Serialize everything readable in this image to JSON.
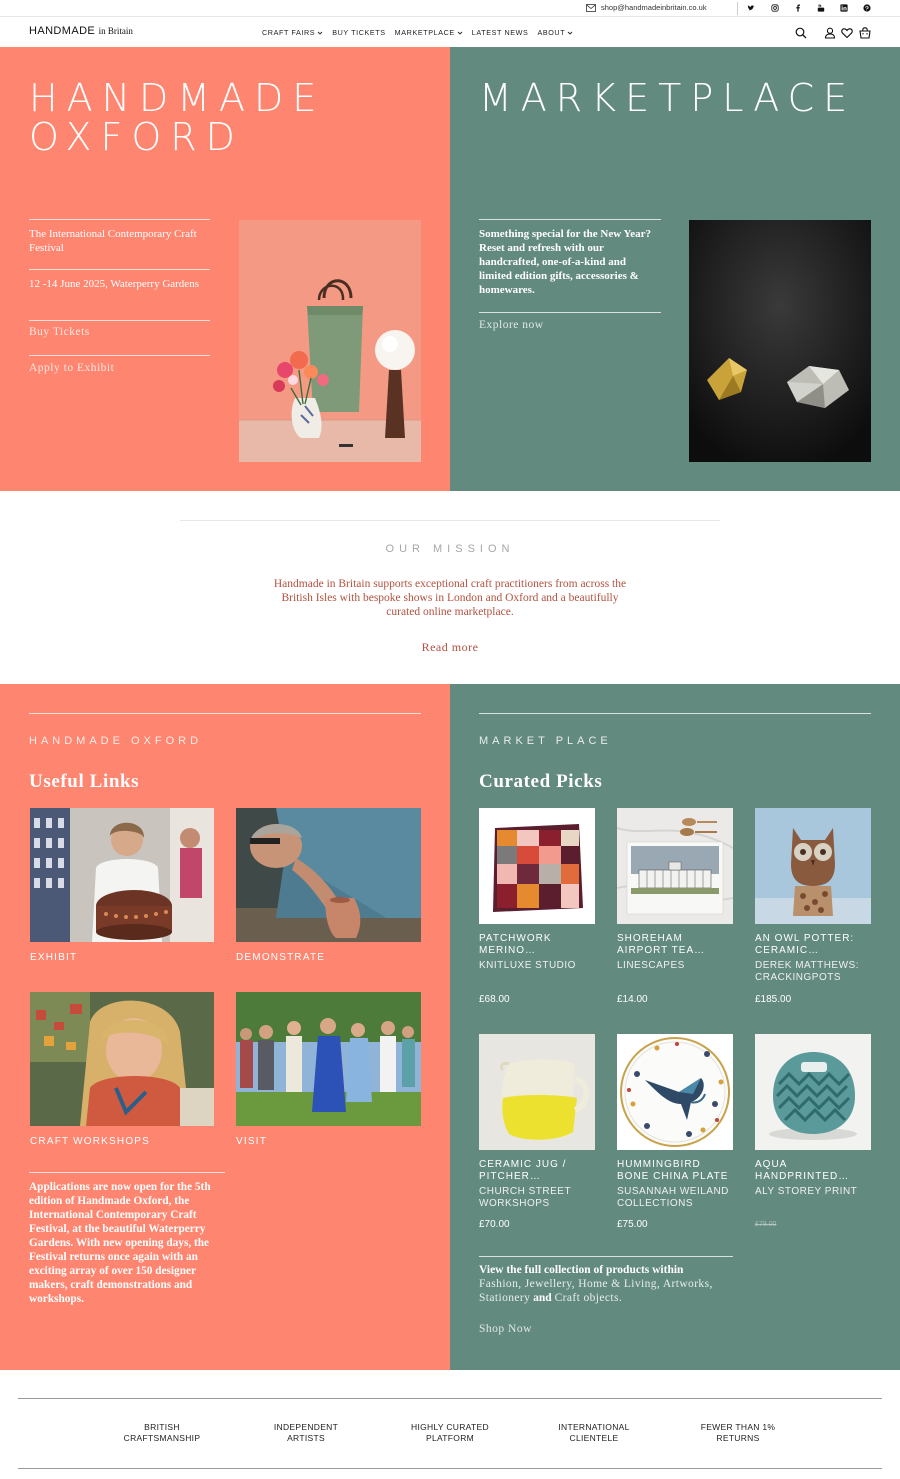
{
  "topbar": {
    "email": "shop@handmadeinbritain.co.uk",
    "social_icons": [
      "twitter-icon",
      "instagram-icon",
      "facebook-icon",
      "youtube-icon",
      "linkedin-icon",
      "pinterest-icon"
    ]
  },
  "header": {
    "logo_main": "HANDMADE",
    "logo_small": "in Britain",
    "nav": [
      {
        "label": "CRAFT FAIRS",
        "dropdown": true
      },
      {
        "label": "BUY TICKETS",
        "dropdown": false
      },
      {
        "label": "MARKETPLACE",
        "dropdown": true
      },
      {
        "label": "LATEST NEWS",
        "dropdown": false
      },
      {
        "label": "ABOUT",
        "dropdown": true
      }
    ],
    "icons": [
      "search-icon",
      "account-icon",
      "wishlist-icon",
      "cart-icon"
    ]
  },
  "hero_left": {
    "title_line1": "HANDMADE",
    "title_line2": "OXFORD",
    "festival": "The International Contemporary Craft Festival",
    "dates": "12 -14 June 2025, Waterperry Gardens",
    "buy_tickets": "Buy Tickets",
    "apply": "Apply to Exhibit"
  },
  "hero_right": {
    "title": "MARKETPLACE",
    "blurb": "Something special for the New Year? Reset and refresh with our handcrafted, one-of-a-kind and limited edition gifts, accessories & homewares.",
    "cta": "Explore now"
  },
  "mission": {
    "heading": "OUR MISSION",
    "body": "Handmade in Britain supports exceptional craft practitioners from across the British Isles with bespoke shows in London and Oxford and a beautifully curated online marketplace.",
    "read_more": "Read more"
  },
  "oxford_section": {
    "eyebrow": "HANDMADE OXFORD",
    "title": "Useful Links",
    "tiles": [
      "EXHIBIT",
      "DEMONSTRATE",
      "CRAFT WORKSHOPS",
      "VISIT"
    ],
    "blurb": "Applications are now open for the 5th edition of Handmade Oxford, the International Contemporary Craft Festival, at the beautiful Waterperry Gardens. With new opening days, the Festival returns once again with an exciting array of over 150 designer makers, craft demonstrations and workshops."
  },
  "market_section": {
    "eyebrow": "MARKET PLACE",
    "title": "Curated Picks",
    "products": [
      {
        "title": "PATCHWORK MERINO…",
        "maker": "KNITLUXE STUDIO",
        "price": "£68.00",
        "struck": false
      },
      {
        "title": "SHOREHAM AIRPORT TEA…",
        "maker": "LINESCAPES",
        "price": "£14.00",
        "struck": false
      },
      {
        "title": "AN OWL POTTER: CERAMIC…",
        "maker": "DEREK MATTHEWS: CRACKINGPOTS",
        "price": "£185.00",
        "struck": false
      },
      {
        "title": "CERAMIC JUG / PITCHER…",
        "maker": "CHURCH STREET WORKSHOPS",
        "price": "£70.00",
        "struck": false
      },
      {
        "title": "HUMMINGBIRD BONE CHINA PLATE",
        "maker": "SUSANNAH WEILAND COLLECTIONS",
        "price": "£75.00",
        "struck": false
      },
      {
        "title": "AQUA HANDPRINTED…",
        "maker": "ALY STOREY PRINT",
        "price": "£79.00",
        "struck": true
      }
    ],
    "collection_lead": "View the full collection of products within",
    "collection_list": "Fashion, Jewellery, Home & Living, Artworks, Stationery",
    "collection_and": "and",
    "collection_end": "Craft objects.",
    "shop_now": "Shop Now"
  },
  "features": [
    {
      "line1": "BRITISH",
      "line2": "CRAFTSMANSHIP"
    },
    {
      "line1": "INDEPENDENT",
      "line2": "ARTISTS"
    },
    {
      "line1": "HIGHLY CURATED",
      "line2": "PLATFORM"
    },
    {
      "line1": "INTERNATIONAL",
      "line2": "CLIENTELE"
    },
    {
      "line1": "FEWER THAN 1%",
      "line2": "RETURNS"
    }
  ],
  "colors": {
    "salmon": "#fe8570",
    "teal": "#638a7f",
    "mission_text": "#b35240"
  }
}
